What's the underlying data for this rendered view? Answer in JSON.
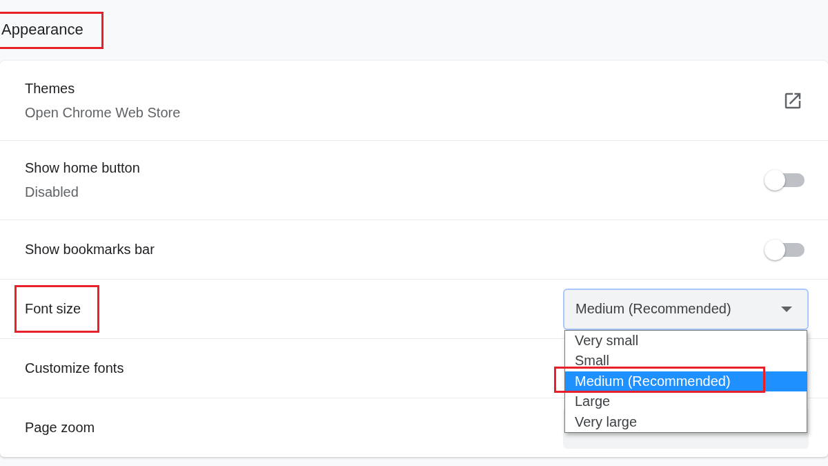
{
  "section": {
    "title": "Appearance",
    "highlighted": true
  },
  "rows": [
    {
      "kind": "link",
      "label": "Themes",
      "sublabel": "Open Chrome Web Store",
      "highlighted": false
    },
    {
      "kind": "toggle",
      "label": "Show home button",
      "sublabel": "Disabled",
      "on": false,
      "highlighted": false
    },
    {
      "kind": "toggle",
      "label": "Show bookmarks bar",
      "on": false,
      "highlighted": false
    },
    {
      "kind": "select",
      "label": "Font size",
      "value": "Medium (Recommended)",
      "expanded": true,
      "highlighted": true,
      "options": [
        {
          "label": "Very small",
          "selected": false,
          "highlighted": false
        },
        {
          "label": "Small",
          "selected": false,
          "highlighted": false
        },
        {
          "label": "Medium (Recommended)",
          "selected": true,
          "highlighted": true
        },
        {
          "label": "Large",
          "selected": false,
          "highlighted": false
        },
        {
          "label": "Very large",
          "selected": false,
          "highlighted": false
        }
      ]
    },
    {
      "kind": "plain",
      "label": "Customize fonts",
      "highlighted": false
    },
    {
      "kind": "select",
      "label": "Page zoom",
      "expanded": false,
      "highlighted": false
    }
  ]
}
